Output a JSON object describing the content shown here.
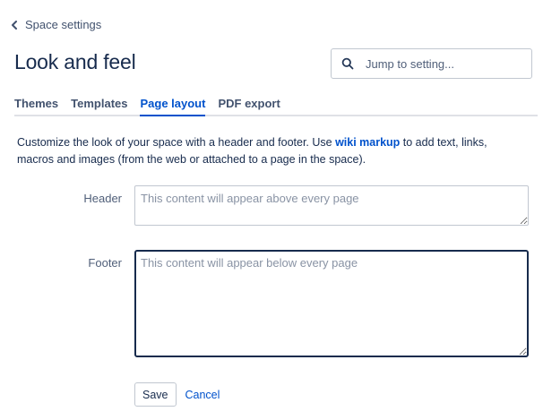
{
  "breadcrumb": {
    "back_label": "Space settings",
    "icon": "chevron-left-icon"
  },
  "page": {
    "title": "Look and feel"
  },
  "search": {
    "placeholder": "Jump to setting...",
    "value": "",
    "icon": "search-icon"
  },
  "tabs": [
    {
      "label": "Themes",
      "active": false
    },
    {
      "label": "Templates",
      "active": false
    },
    {
      "label": "Page layout",
      "active": true
    },
    {
      "label": "PDF export",
      "active": false
    }
  ],
  "description": {
    "before_link": "Customize the look of your space with a header and footer. Use ",
    "link_text": "wiki markup",
    "after_link": " to add text, links, macros and images (from the web or attached to a page in the space)."
  },
  "form": {
    "header": {
      "label": "Header",
      "placeholder": "This content will appear above every page",
      "value": ""
    },
    "footer": {
      "label": "Footer",
      "placeholder": "This content will appear below every page",
      "value": ""
    }
  },
  "actions": {
    "save_label": "Save",
    "cancel_label": "Cancel"
  },
  "colors": {
    "accent": "#0052cc",
    "text": "#172b4d",
    "muted": "#42526e",
    "border": "#c1c7d0"
  }
}
